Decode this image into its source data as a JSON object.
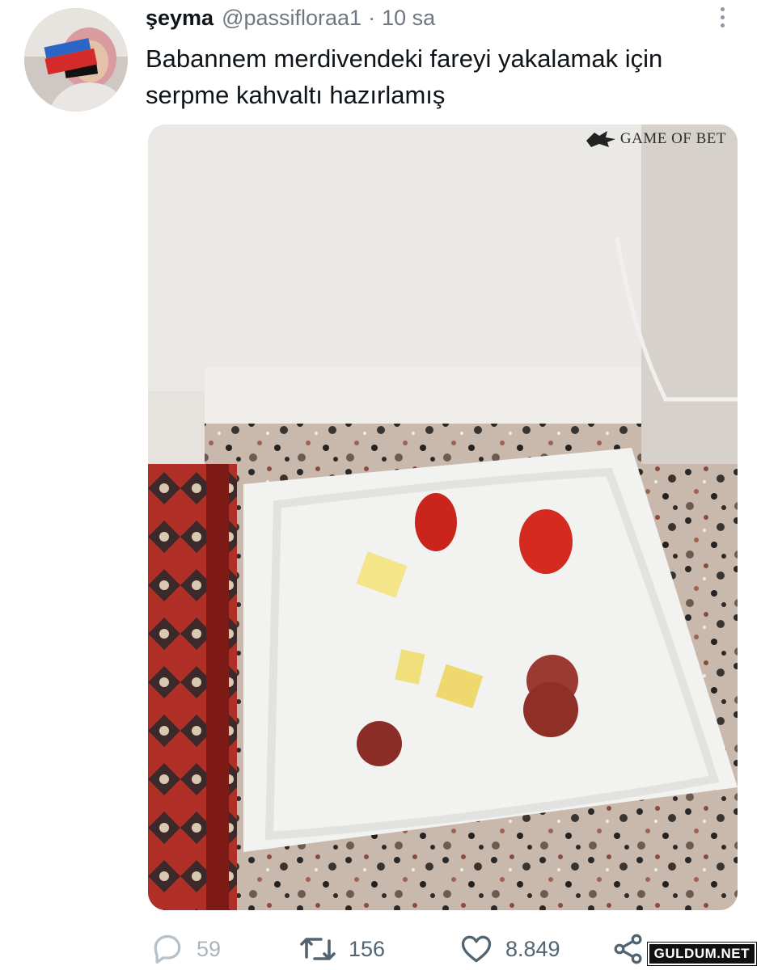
{
  "tweet": {
    "display_name": "şeyma",
    "handle": "@passifloraa1",
    "separator": "·",
    "time": "10 sa",
    "text": "Babannem merdivendeki fareyi yakalamak için serpme kahvaltı hazırlamış",
    "avatar": {
      "badge_small": "Breaking",
      "badge_large": "NEWS"
    }
  },
  "media": {
    "watermark": "GAME OF BET",
    "icon": "wolf-head-icon"
  },
  "actions": {
    "reply": {
      "icon": "reply-icon",
      "count": "59"
    },
    "retweet": {
      "icon": "retweet-icon",
      "count": "156"
    },
    "like": {
      "icon": "heart-icon",
      "count": "8.849"
    },
    "share": {
      "icon": "share-icon"
    }
  },
  "site_watermark": "GULDUM.NET",
  "colors": {
    "text": "#0f1419",
    "muted": "#6e7781",
    "tomato": "#d42a20",
    "cheese": "#f4e58a",
    "sucuk": "#8e2f28"
  }
}
